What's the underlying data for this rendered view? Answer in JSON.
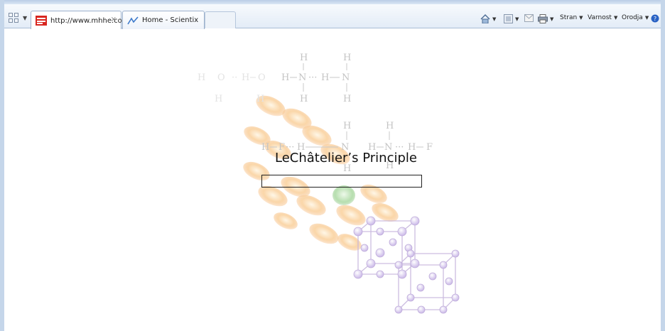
{
  "browser": {
    "tabs": [
      {
        "label": "http://www.mhhe.com...",
        "close": "×",
        "active": true
      },
      {
        "label": "Home - Scientix",
        "active": false
      }
    ],
    "commands": {
      "page": "Stran",
      "safety": "Varnost",
      "tools": "Orodja"
    }
  },
  "main": {
    "title": "LeChâtelier’s Principle",
    "progress": 0
  },
  "chemistry": {
    "atom_h": "H",
    "atom_f": "F",
    "atom_n": "N",
    "atom_o": "O"
  },
  "colors": {
    "accent": "#4a7fd4",
    "help": "#2a62c4",
    "tab_favicon": "#d8261f"
  }
}
